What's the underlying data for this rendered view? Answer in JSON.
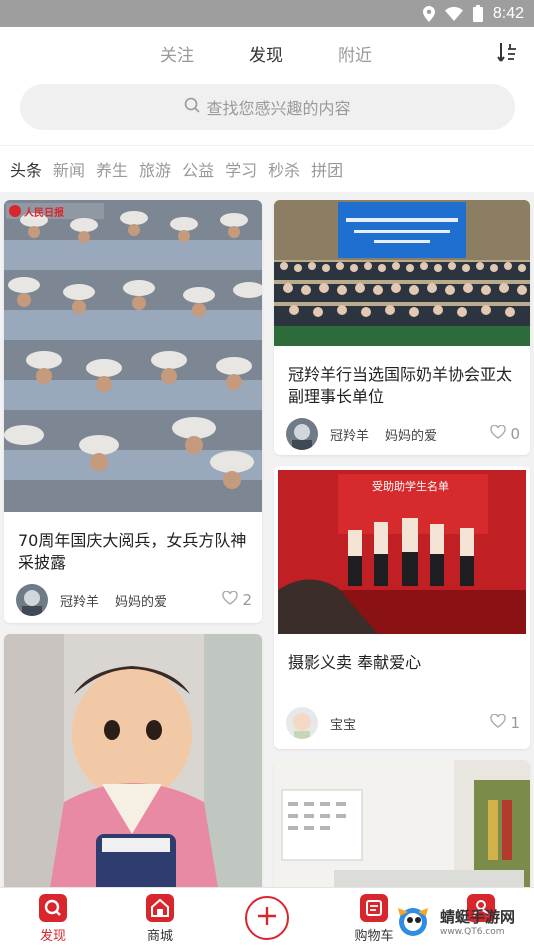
{
  "status_bar": {
    "time": "8:42",
    "icons": [
      "location-icon",
      "wifi-icon",
      "battery-icon"
    ]
  },
  "tabs": [
    {
      "label": "关注",
      "active": false
    },
    {
      "label": "发现",
      "active": true
    },
    {
      "label": "附近",
      "active": false
    }
  ],
  "search": {
    "placeholder": "查找您感兴趣的内容"
  },
  "categories": [
    "头条",
    "新闻",
    "养生",
    "旅游",
    "公益",
    "学习",
    "秒杀",
    "拼团"
  ],
  "feed": [
    {
      "title": "70周年国庆大阅兵，女兵方队神采披露",
      "author": "冠羚羊",
      "tag": "妈妈的爱",
      "likes": "2",
      "image": "parade-photo",
      "image_caption": "人民日报"
    },
    {
      "title": "冠羚羊行当选国际奶羊协会亚太副理事长单位",
      "author": "冠羚羊",
      "tag": "妈妈的爱",
      "likes": "0",
      "image": "conference-group-photo"
    },
    {
      "title": "摄影义卖  奉献爱心",
      "author": "宝宝",
      "tag": "",
      "likes": "1",
      "image": "charity-stage-photo",
      "image_caption": "受助助学生名单"
    },
    {
      "title": "",
      "image": "baby-photo"
    },
    {
      "title": "",
      "image": "calendar-photo"
    }
  ],
  "bottom_nav": [
    {
      "label": "发现",
      "active": true,
      "icon": "discover-icon"
    },
    {
      "label": "商城",
      "active": false,
      "icon": "home-store-icon"
    },
    {
      "label": "",
      "active": false,
      "icon": "add-icon"
    },
    {
      "label": "购物车",
      "active": false,
      "icon": "cart-list-icon"
    },
    {
      "label": "",
      "active": false,
      "icon": "profile-icon"
    }
  ],
  "watermark": {
    "text": "蜻蜓手游网",
    "sub": "www.QT6.com"
  },
  "colors": {
    "accent": "#d9262d",
    "muted": "#999999"
  }
}
